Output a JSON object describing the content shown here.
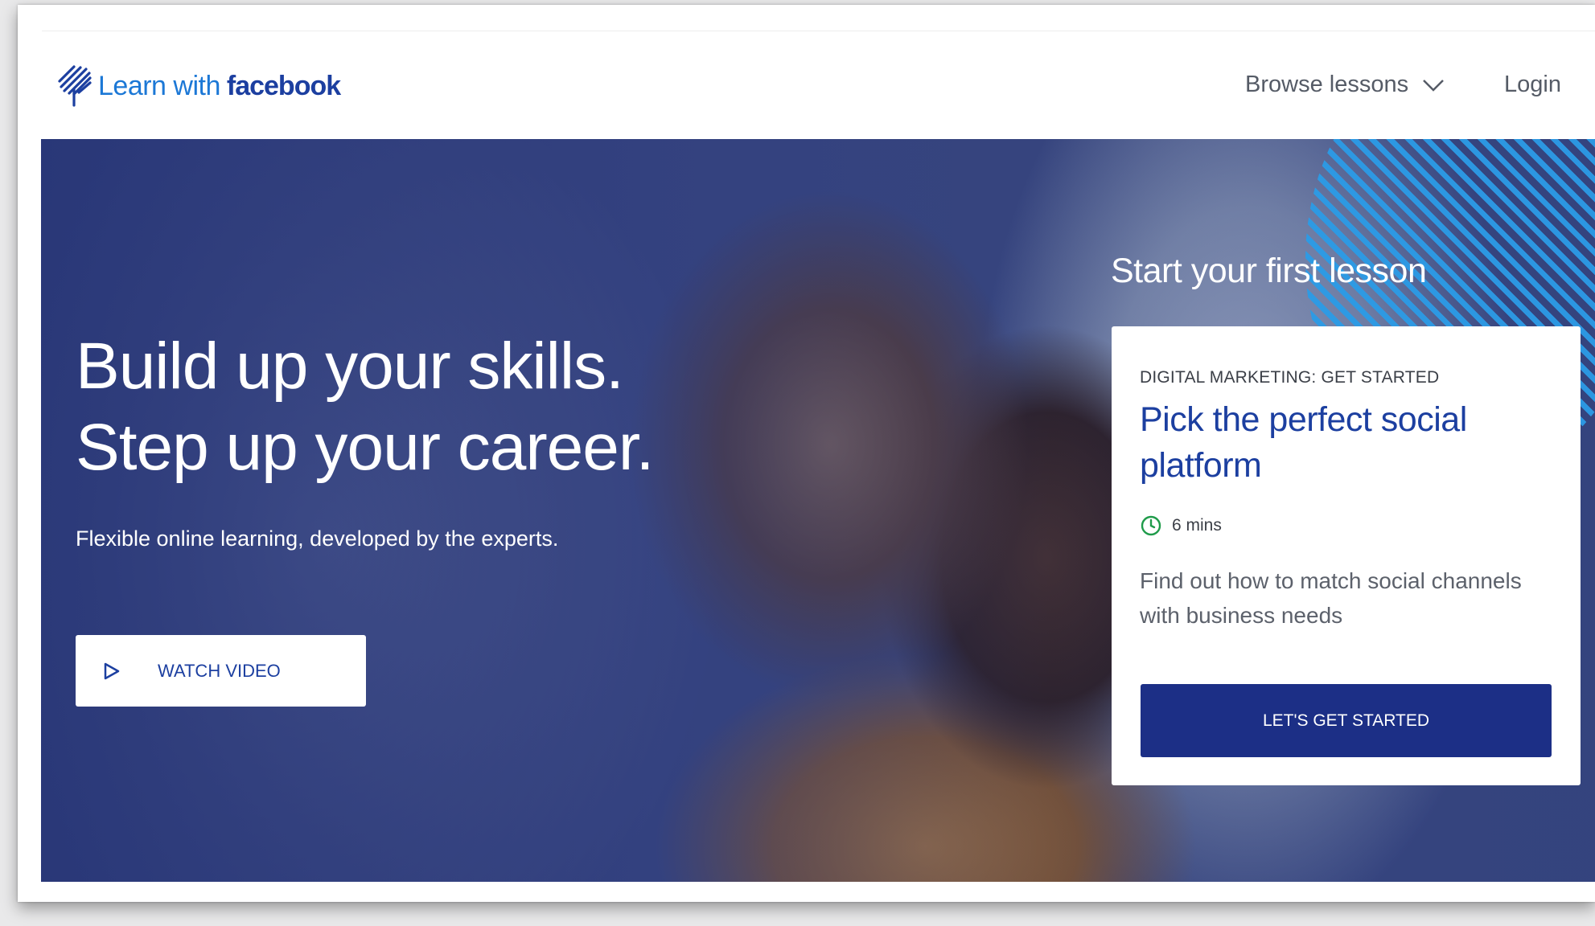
{
  "header": {
    "logo": {
      "learn": "Learn with",
      "brand": "facebook"
    },
    "nav": {
      "browse_label": "Browse lessons",
      "login_label": "Login"
    }
  },
  "hero": {
    "title_line1": "Build up your skills.",
    "title_line2": "Step up your career.",
    "subtitle": "Flexible online learning, developed by the experts.",
    "watch_label": "WATCH VIDEO"
  },
  "lesson": {
    "heading": "Start your first lesson",
    "category": "DIGITAL MARKETING: GET STARTED",
    "title": "Pick the perfect social platform",
    "duration": "6 mins",
    "description": "Find out how to match social channels with business needs",
    "cta_label": "LET'S GET STARTED"
  },
  "colors": {
    "brand_blue": "#1c3fa0",
    "logo_blue": "#1c78d6",
    "cta_navy": "#1c2f86",
    "clock_green": "#1f9b4a",
    "stripe_blue": "#2b9be6"
  },
  "icons": {
    "logo": "feather-leaf-icon",
    "browse": "chevron-down-icon",
    "watch": "play-icon",
    "duration": "clock-icon"
  }
}
